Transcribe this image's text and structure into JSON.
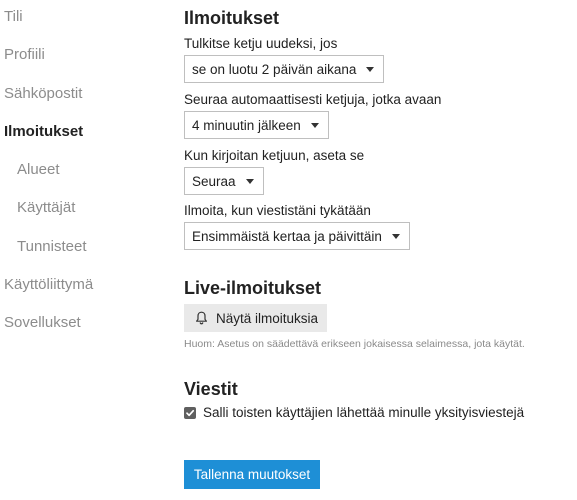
{
  "sidebar": {
    "items": [
      {
        "label": "Tili"
      },
      {
        "label": "Profiili"
      },
      {
        "label": "Sähköpostit"
      },
      {
        "label": "Ilmoitukset"
      },
      {
        "label": "Alueet"
      },
      {
        "label": "Käyttäjät"
      },
      {
        "label": "Tunnisteet"
      },
      {
        "label": "Käyttöliittymä"
      },
      {
        "label": "Sovellukset"
      }
    ],
    "active": "Ilmoitukset"
  },
  "notifications": {
    "title": "Ilmoitukset",
    "new_topic_label": "Tulkitse ketju uudeksi, jos",
    "new_topic_value": "se on luotu 2 päivän aikana",
    "auto_track_label": "Seuraa automaattisesti ketjuja, jotka avaan",
    "auto_track_value": "4 minuutin jälkeen",
    "on_reply_label": "Kun kirjoitan ketjuun, aseta se",
    "on_reply_value": "Seuraa",
    "like_notify_label": "Ilmoita, kun viestistäni tykätään",
    "like_notify_value": "Ensimmäistä kertaa ja päivittäin"
  },
  "live": {
    "title": "Live-ilmoitukset",
    "button_label": "Näytä ilmoituksia",
    "note": "Huom: Asetus on säädettävä erikseen jokaisessa selaimessa, jota käytät."
  },
  "messages": {
    "title": "Viestit",
    "allow_pm_label": "Salli toisten käyttäjien lähettää minulle yksityisviestejä",
    "allow_pm_checked": true
  },
  "save_label": "Tallenna muutokset",
  "colors": {
    "primary": "#1e8fd6",
    "muted_nav": "#8c8c8c",
    "button_gray": "#e9e9e9"
  },
  "icons": {
    "live_button": "bell-icon",
    "select_caret": "caret-down-icon",
    "checkbox": "check-icon"
  }
}
